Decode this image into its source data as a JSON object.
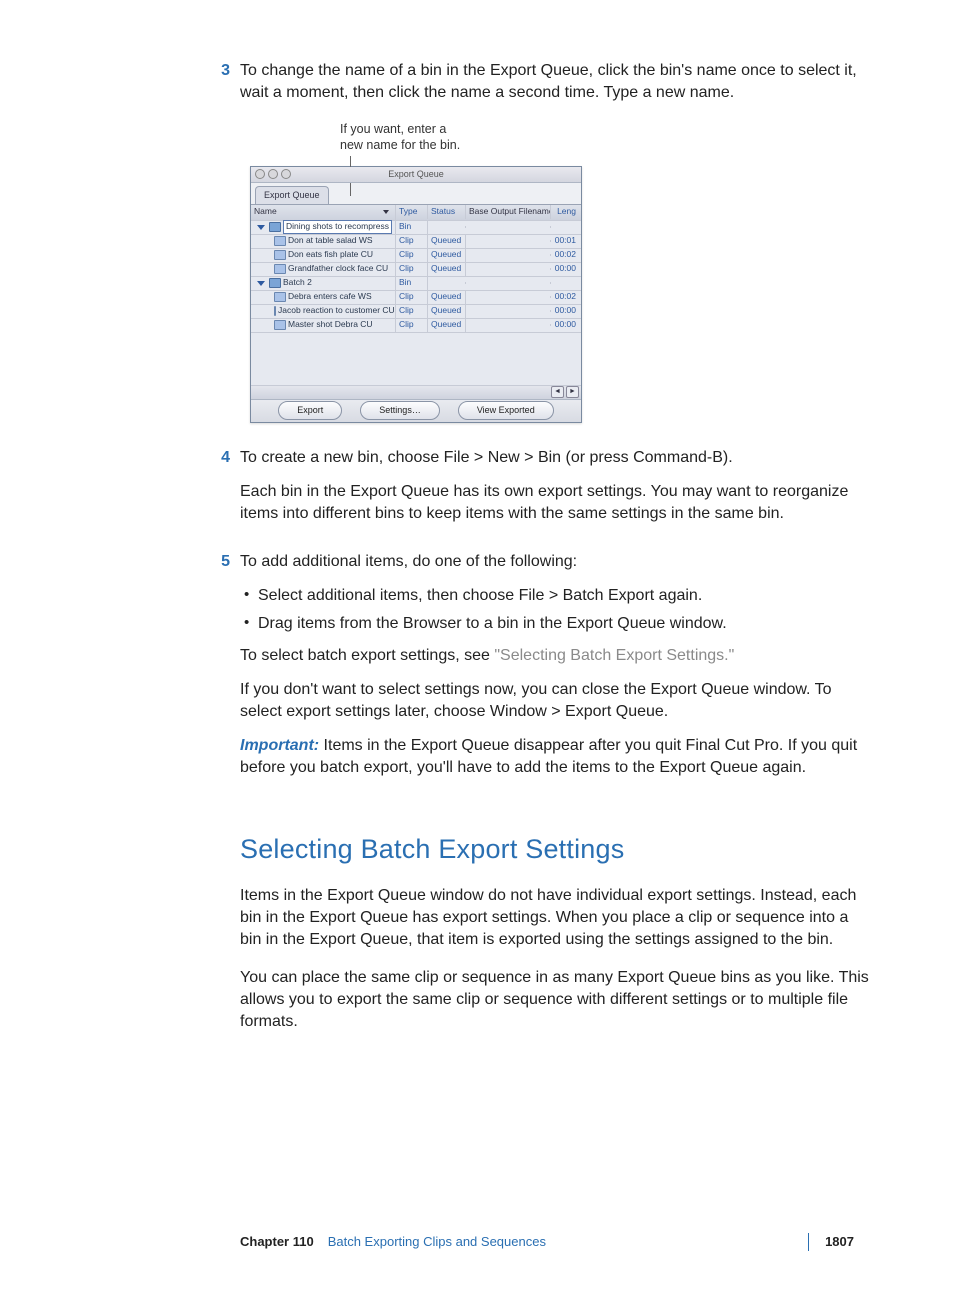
{
  "steps": {
    "s3": {
      "num": "3",
      "text": "To change the name of a bin in the Export Queue, click the bin's name once to select it, wait a moment, then click the name a second time. Type a new name."
    },
    "s4": {
      "num": "4",
      "text": "To create a new bin, choose File > New > Bin (or press Command-B).",
      "follow": "Each bin in the Export Queue has its own export settings. You may want to reorganize items into different bins to keep items with the same settings in the same bin."
    },
    "s5": {
      "num": "5",
      "text": "To add additional items, do one of the following:",
      "bullets": [
        "Select additional items, then choose File > Batch Export again.",
        "Drag items from the Browser to a bin in the Export Queue window."
      ],
      "select_pre": "To select batch export settings, see ",
      "select_link": "\"Selecting Batch Export Settings.\"",
      "close_note": "If you don't want to select settings now, you can close the Export Queue window. To select export settings later, choose Window > Export Queue."
    }
  },
  "important": {
    "label": "Important:",
    "text": "  Items in the Export Queue disappear after you quit Final Cut Pro. If you quit before you batch export, you'll have to add the items to the Export Queue again."
  },
  "section": {
    "title": "Selecting Batch Export Settings",
    "p1": "Items in the Export Queue window do not have individual export settings. Instead, each bin in the Export Queue has export settings. When you place a clip or sequence into a bin in the Export Queue, that item is exported using the settings assigned to the bin.",
    "p2": "You can place the same clip or sequence in as many Export Queue bins as you like. This allows you to export the same clip or sequence with different settings or to multiple file formats."
  },
  "figure": {
    "callout_l1": "If you want, enter a",
    "callout_l2": "new name for the bin.",
    "window_title": "Export Queue",
    "tab": "Export Queue",
    "cols": {
      "name": "Name",
      "type": "Type",
      "status": "Status",
      "base": "Base Output Filename",
      "len": "Leng"
    },
    "rows": [
      {
        "kind": "bin",
        "name": "Dining shots to recompress",
        "type": "Bin",
        "status": "",
        "len": ""
      },
      {
        "kind": "clip",
        "name": "Don at table salad WS",
        "type": "Clip",
        "status": "Queued",
        "len": "00:01"
      },
      {
        "kind": "clip",
        "name": "Don eats fish plate CU",
        "type": "Clip",
        "status": "Queued",
        "len": "00:02"
      },
      {
        "kind": "clip",
        "name": "Grandfather clock face CU",
        "type": "Clip",
        "status": "Queued",
        "len": "00:00"
      },
      {
        "kind": "bin",
        "name": "Batch 2",
        "type": "Bin",
        "status": "",
        "len": ""
      },
      {
        "kind": "clip",
        "name": "Debra enters cafe WS",
        "type": "Clip",
        "status": "Queued",
        "len": "00:02"
      },
      {
        "kind": "clip",
        "name": "Jacob reaction to customer CU",
        "type": "Clip",
        "status": "Queued",
        "len": "00:00"
      },
      {
        "kind": "clip",
        "name": "Master shot Debra CU",
        "type": "Clip",
        "status": "Queued",
        "len": "00:00"
      }
    ],
    "buttons": {
      "export": "Export",
      "settings": "Settings…",
      "view": "View Exported"
    }
  },
  "footer": {
    "chapter": "Chapter 110",
    "title": "Batch Exporting Clips and Sequences",
    "page": "1807"
  }
}
